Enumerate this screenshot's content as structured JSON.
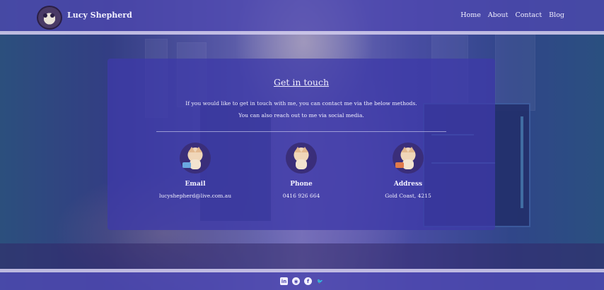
{
  "header": {
    "brand": "Lucy Shepherd",
    "nav": [
      "Home",
      "About",
      "Contact",
      "Blog"
    ]
  },
  "main": {
    "title": "Get in touch",
    "intro_line1": "If you would like to get in touch with me, you can contact me via the below methods.",
    "intro_line2": "You can also reach out to me via social media.",
    "contacts": [
      {
        "label": "Email",
        "value": "lucyshepherd@live.com.au",
        "icon": "cat-laptop-avatar"
      },
      {
        "label": "Phone",
        "value": "0416 926 664",
        "icon": "cat-phone-avatar"
      },
      {
        "label": "Address",
        "value": "Gold Coast, 4215",
        "icon": "cat-desk-avatar"
      }
    ]
  },
  "footer": {
    "social": [
      {
        "name": "linkedin-icon",
        "glyph": "in"
      },
      {
        "name": "github-icon",
        "glyph": "◉"
      },
      {
        "name": "facebook-icon",
        "glyph": "f"
      },
      {
        "name": "twitter-icon",
        "glyph": "🐦"
      }
    ]
  },
  "colors": {
    "header_bg": "#4e48af",
    "card_bg": "#3e3aa8",
    "text": "#f2f0ff",
    "rule": "#cdc8eb"
  }
}
